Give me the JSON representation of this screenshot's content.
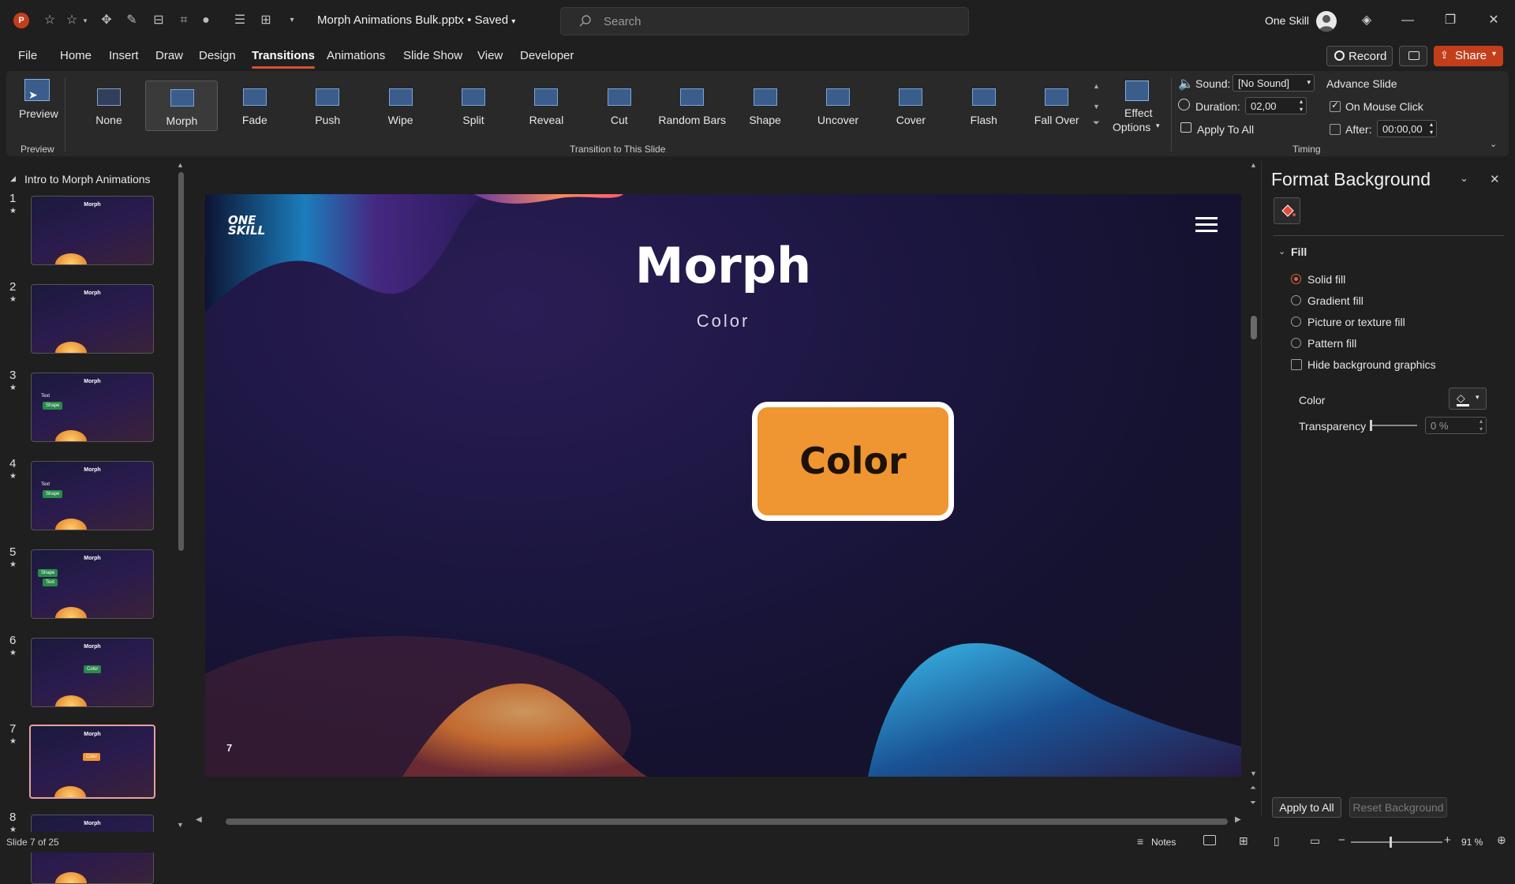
{
  "app": {
    "doc_title": "Morph Animations Bulk.pptx • Saved",
    "search_placeholder": "Search",
    "user_name": "One Skill"
  },
  "menu": {
    "tabs": [
      "File",
      "Home",
      "Insert",
      "Draw",
      "Design",
      "Transitions",
      "Animations",
      "Slide Show",
      "View",
      "Developer"
    ],
    "active": "Transitions",
    "record": "Record",
    "share": "Share"
  },
  "ribbon": {
    "preview_label": "Preview",
    "preview_group": "Preview",
    "transitions": [
      "None",
      "Morph",
      "Fade",
      "Push",
      "Wipe",
      "Split",
      "Reveal",
      "Cut",
      "Random Bars",
      "Shape",
      "Uncover",
      "Cover",
      "Flash",
      "Fall Over"
    ],
    "selected_transition": "Morph",
    "effect_options": [
      "Effect",
      "Options"
    ],
    "transition_group": "Transition to This Slide",
    "sound_label": "Sound:",
    "sound_value": "[No Sound]",
    "duration_label": "Duration:",
    "duration_value": "02,00",
    "apply_all": "Apply To All",
    "advance_title": "Advance Slide",
    "on_mouse_click": "On Mouse Click",
    "on_mouse_click_checked": true,
    "after_label": "After:",
    "after_value": "00:00,00",
    "after_checked": false,
    "timing_group": "Timing"
  },
  "slides_panel": {
    "section": "Intro to Morph Animations",
    "slides": [
      {
        "num": "1",
        "title": "Morph"
      },
      {
        "num": "2",
        "title": "Morph"
      },
      {
        "num": "3",
        "title": "Morph",
        "extra": [
          "Text",
          "Shape"
        ]
      },
      {
        "num": "4",
        "title": "Morph",
        "extra": [
          "Text",
          "Shape"
        ]
      },
      {
        "num": "5",
        "title": "Morph",
        "extra": [
          "Shape",
          "Text"
        ]
      },
      {
        "num": "6",
        "title": "Morph",
        "extra": [
          "Color"
        ]
      },
      {
        "num": "7",
        "title": "Morph",
        "extra": [
          "Color"
        ]
      },
      {
        "num": "8",
        "title": "Morph"
      }
    ],
    "selected": 7
  },
  "slide": {
    "logo_line1": "ONE",
    "logo_line2": "SKILL",
    "title": "Morph",
    "subtitle": "Color",
    "box_text": "Color",
    "number": "7"
  },
  "format_pane": {
    "title": "Format Background",
    "section": "Fill",
    "options": [
      "Solid fill",
      "Gradient fill",
      "Picture or texture fill",
      "Pattern fill"
    ],
    "selected_option": "Solid fill",
    "hide_bg": "Hide background graphics",
    "color_label": "Color",
    "transparency_label": "Transparency",
    "transparency_value": "0 %",
    "transparency_level": 0,
    "apply_all": "Apply to All",
    "reset": "Reset Background"
  },
  "status": {
    "slide_info": "Slide 7 of 25",
    "notes": "Notes",
    "zoom": "91 %"
  },
  "colors": {
    "accent": "#d35230",
    "box": "#ef9531",
    "share": "#c43e1c"
  }
}
